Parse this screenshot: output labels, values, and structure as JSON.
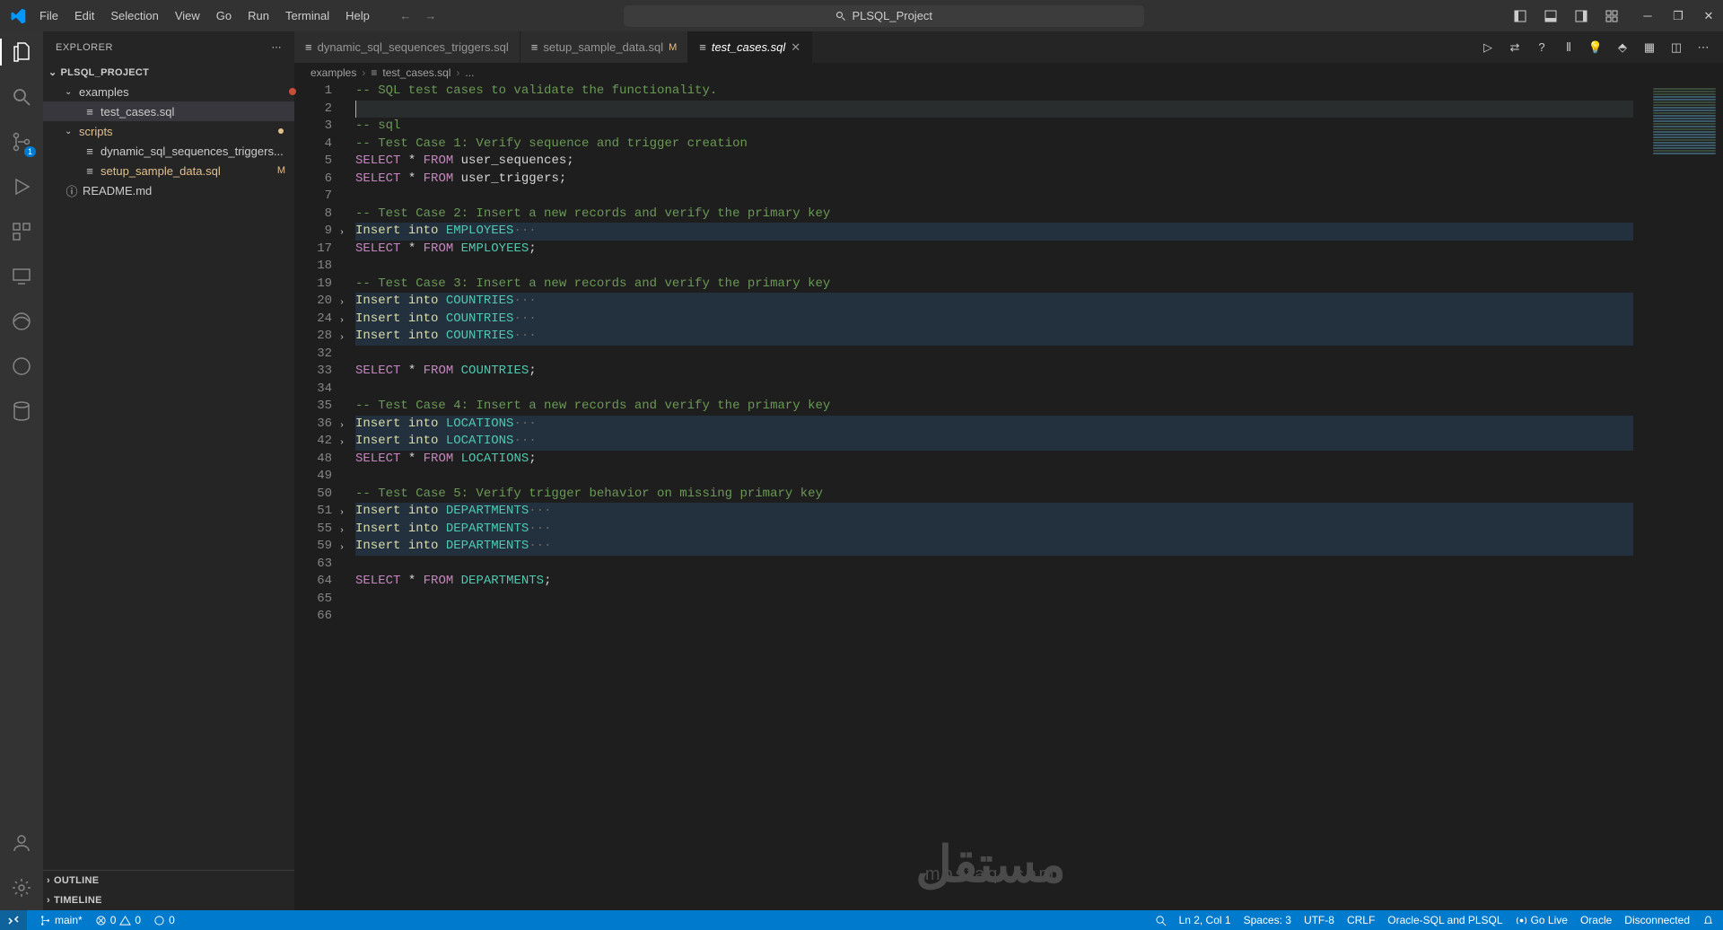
{
  "title": "PLSQL_Project",
  "menu": [
    "File",
    "Edit",
    "Selection",
    "View",
    "Go",
    "Run",
    "Terminal",
    "Help"
  ],
  "explorer": {
    "label": "EXPLORER",
    "project": "PLSQL_PROJECT",
    "tree": {
      "examples": "examples",
      "test_cases": "test_cases.sql",
      "scripts": "scripts",
      "dyn": "dynamic_sql_sequences_triggers...",
      "setup": "setup_sample_data.sql",
      "readme": "README.md",
      "setup_mod": "M"
    },
    "outline": "OUTLINE",
    "timeline": "TIMELINE"
  },
  "scm_badge": "1",
  "tabs": [
    {
      "label": "dynamic_sql_sequences_triggers.sql",
      "mod": ""
    },
    {
      "label": "setup_sample_data.sql",
      "mod": "M"
    },
    {
      "label": "test_cases.sql",
      "mod": ""
    }
  ],
  "breadcrumb": {
    "p0": "examples",
    "p1": "test_cases.sql",
    "p2": "..."
  },
  "code": {
    "line_numbers": [
      "1",
      "2",
      "3",
      "4",
      "5",
      "6",
      "7",
      "8",
      "9",
      "17",
      "18",
      "19",
      "20",
      "24",
      "28",
      "32",
      "33",
      "34",
      "35",
      "36",
      "42",
      "48",
      "49",
      "50",
      "51",
      "55",
      "59",
      "63",
      "64",
      "65",
      "66"
    ],
    "folds": {
      "9": true,
      "20": true,
      "24": true,
      "28": true,
      "36": true,
      "42": true,
      "51": true,
      "55": true,
      "59": true
    },
    "t_comment1": "-- SQL test cases to validate the functionality.",
    "t_comment_sql": "-- sql",
    "t_tc1": "-- Test Case 1: Verify sequence and trigger creation",
    "t_tc2": "-- Test Case 2: Insert a new records and verify the primary key",
    "t_tc3": "-- Test Case 3: Insert a new records and verify the primary key",
    "t_tc4": "-- Test Case 4: Insert a new records and verify the primary key",
    "t_tc5": "-- Test Case 5: Verify trigger behavior on missing primary key",
    "kw_select": "SELECT",
    "kw_from": "FROM",
    "kw_insert": "Insert",
    "kw_into": "into",
    "star": "*",
    "tbl_user_seq": "user_sequences",
    "tbl_user_trg": "user_triggers",
    "tbl_emp": "EMPLOYEES",
    "tbl_countries": "COUNTRIES",
    "tbl_locations": "LOCATIONS",
    "tbl_dept": "DEPARTMENTS",
    "semi": ";",
    "dots": "···"
  },
  "watermark": {
    "big": "مستقل",
    "small": "mostaql.com"
  },
  "status": {
    "branch": "main*",
    "errors": "0",
    "warnings": "0",
    "ports": "0",
    "ln": "Ln 2, Col 1",
    "spaces": "Spaces: 3",
    "encoding": "UTF-8",
    "eol": "CRLF",
    "lang": "Oracle-SQL and PLSQL",
    "golive": "Go Live",
    "oracle": "Oracle",
    "disc": "Disconnected"
  }
}
